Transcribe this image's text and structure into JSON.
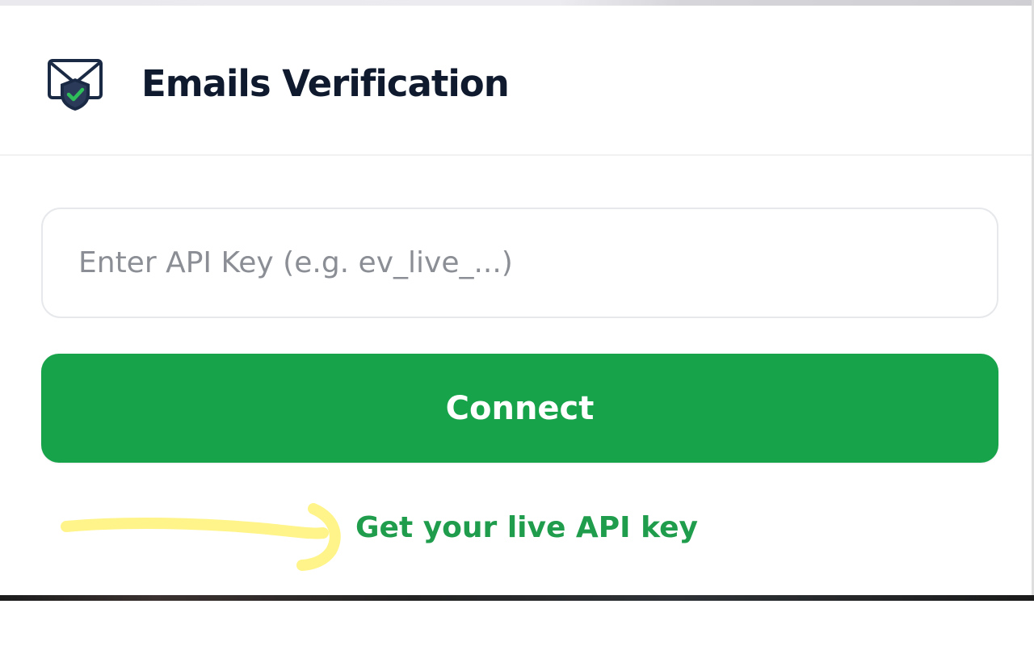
{
  "app": {
    "title": "Emails Verification",
    "logo_icon": "envelope-shield-check-icon"
  },
  "form": {
    "api_key_value": "",
    "api_key_placeholder": "Enter API Key (e.g. ev_live_...)",
    "connect_label": "Connect"
  },
  "footer": {
    "live_key_link": "Get your live API key",
    "annotation_icon": "hand-drawn-arrow-icon"
  },
  "colors": {
    "accent": "#17a34a",
    "link": "#1f9d4c",
    "title": "#0f1a2e",
    "annotation": "#fff48a"
  }
}
